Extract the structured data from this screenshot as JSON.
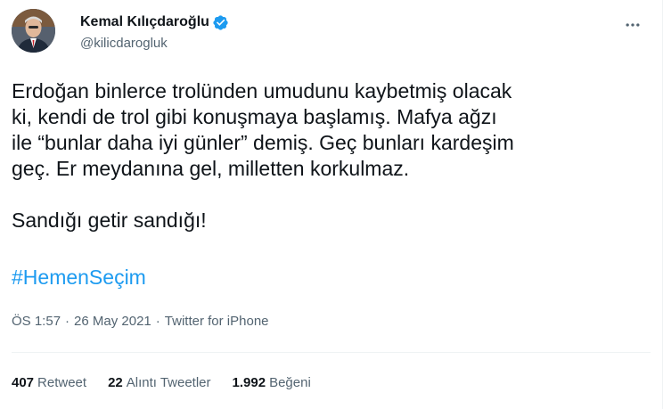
{
  "tweet": {
    "display_name": "Kemal Kılıçdaroğlu",
    "handle": "@kilicdarogluk",
    "verified": true,
    "body": "Erdoğan binlerce trolünden umudunu kaybetmiş olacak\nki, kendi de trol gibi konuşmaya başlamış. Mafya ağzı\nile “bunlar daha iyi günler” demiş. Geç bunları kardeşim\ngeç. Er meydanına gel, milletten korkulmaz.\n\nSandığı getir sandığı!",
    "hashtag": "#HemenSeçim",
    "time": "ÖS 1:57",
    "separator": "·",
    "date": "26 May 2021",
    "source": "Twitter for iPhone"
  },
  "stats": {
    "retweets_count": "407",
    "retweets_label": "Retweet",
    "quotes_count": "22",
    "quotes_label": "Alıntı Tweetler",
    "likes_count": "1.992",
    "likes_label": "Beğeni"
  },
  "colors": {
    "accent": "#1d9bf0",
    "secondary_text": "#536471",
    "primary_text": "#0f1419",
    "divider": "#eff3f4"
  },
  "icons": {
    "verified": "verified-badge-icon",
    "more": "more-horizontal-icon"
  }
}
